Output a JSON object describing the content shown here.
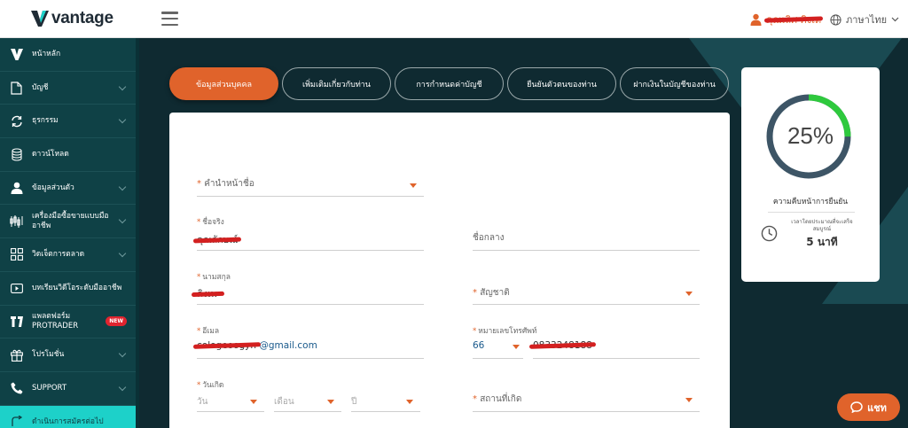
{
  "brand": {
    "name": "vantage"
  },
  "header": {
    "user_name": "คุณเลิศ คิงเด",
    "language": "ภาษาไทย"
  },
  "sidebar": {
    "items": [
      {
        "label": "หน้าหลัก",
        "icon": "vantage-logo-icon",
        "has_chevron": false
      },
      {
        "label": "บัญชี",
        "icon": "document-icon",
        "has_chevron": true
      },
      {
        "label": "ธุรกรรม",
        "icon": "exchange-icon",
        "has_chevron": true
      },
      {
        "label": "ดาวน์โหลด",
        "icon": "database-icon",
        "has_chevron": false
      },
      {
        "label": "ข้อมูลส่วนตัว",
        "icon": "user-icon",
        "has_chevron": true
      },
      {
        "label": "เครื่องมือซื้อขายแบบมืออาชีพ",
        "icon": "candlestick-icon",
        "has_chevron": true
      },
      {
        "label": "วิดเจ็ตการตลาด",
        "icon": "widgets-icon",
        "has_chevron": true
      },
      {
        "label": "บทเรียนวิดีโอระดับมืออาชีพ",
        "icon": "video-icon",
        "has_chevron": false
      },
      {
        "label": "แพลตฟอร์ม PROTRADER",
        "icon": "protrader-icon",
        "has_chevron": false,
        "badge": "NEW"
      },
      {
        "label": "โปรโมชั่น",
        "icon": "gift-icon",
        "has_chevron": true
      },
      {
        "label": "SUPPORT",
        "icon": "phone-icon",
        "has_chevron": true
      },
      {
        "label": "ดำเนินการสมัครต่อไป",
        "icon": "arrow-icon",
        "has_chevron": false,
        "active": true
      }
    ]
  },
  "tabs": [
    {
      "label": "ข้อมูลส่วนบุคคล",
      "active": true
    },
    {
      "label": "เพิ่มเติมเกี่ยวกับท่าน",
      "active": false
    },
    {
      "label": "การกำหนดค่าบัญชี",
      "active": false
    },
    {
      "label": "ยืนยันตัวตนของท่าน",
      "active": false
    },
    {
      "label": "ฝากเงินในบัญชีของท่าน",
      "active": false
    }
  ],
  "form": {
    "title_field": {
      "label": "คำนำหน้าชื่อ",
      "required": true
    },
    "first_name": {
      "label": "ชื่อจริง",
      "required": true,
      "value": "คุณลักษณ์"
    },
    "middle_name": {
      "label": "ชื่อกลาง",
      "required": false
    },
    "last_name": {
      "label": "นามสกุล",
      "required": true,
      "value": "คิงเพ"
    },
    "nationality": {
      "label": "สัญชาติ",
      "required": true
    },
    "email": {
      "label": "อีเมล",
      "required": true,
      "value_suffix": "@gmail.com",
      "value_prefix": "cologeoogyn"
    },
    "phone": {
      "label": "หมายเลขโทรศัพท์",
      "required": true,
      "country_code": "66",
      "value": "0833248188"
    },
    "dob": {
      "label": "วันเกิด",
      "required": true,
      "day": "วัน",
      "month": "เดือน",
      "year": "ปี"
    },
    "birthplace": {
      "label": "สถานที่เกิด",
      "required": true
    }
  },
  "progress": {
    "percent_label": "25%",
    "fraction": 0.25,
    "title": "ความคืบหน้าการยืนยัน",
    "time_label": "เวลาโดยประมาณที่จะเสร็จสมบูรณ์",
    "time_value": "5 นาที"
  },
  "chat": {
    "label": "แชท"
  },
  "colors": {
    "accent": "#e0632b",
    "sidebar": "#0f4146",
    "active_item": "#1dd1c9",
    "progress": "#2ec93d",
    "ring": "#3d5566"
  }
}
